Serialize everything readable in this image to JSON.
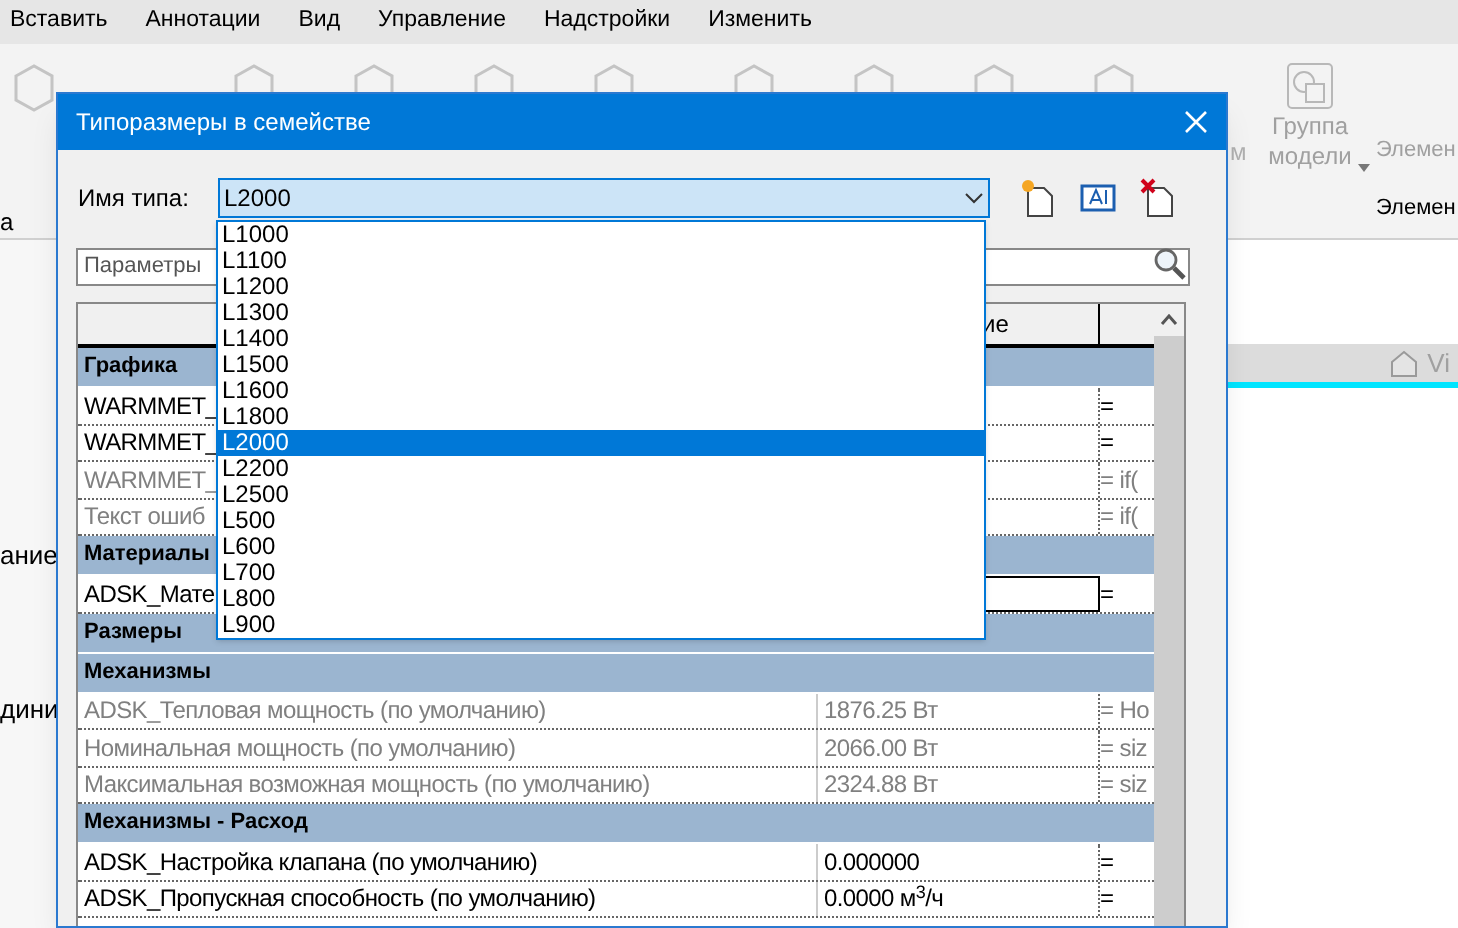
{
  "app": {
    "menu": [
      "Вставить",
      "Аннотации",
      "Вид",
      "Управление",
      "Надстройки",
      "Изменить"
    ],
    "ribbon": {
      "left_label": "а",
      "partial_label": "м",
      "group_button": [
        "Группа",
        "модели"
      ],
      "right_labels": [
        "Элемен",
        "Элемен"
      ]
    },
    "left_panel": [
      "ание",
      "дини"
    ],
    "view_tab": "Vi"
  },
  "dialog": {
    "title": "Типоразмеры в семействе",
    "type_name_label": "Имя типа:",
    "type_name_value": "L2000",
    "dropdown": [
      {
        "label": "L1000",
        "selected": false
      },
      {
        "label": "L1100",
        "selected": false
      },
      {
        "label": "L1200",
        "selected": false
      },
      {
        "label": "L1300",
        "selected": false
      },
      {
        "label": "L1400",
        "selected": false
      },
      {
        "label": "L1500",
        "selected": false
      },
      {
        "label": "L1600",
        "selected": false
      },
      {
        "label": "L1800",
        "selected": false
      },
      {
        "label": "L2000",
        "selected": true
      },
      {
        "label": "L2200",
        "selected": false
      },
      {
        "label": "L2500",
        "selected": false
      },
      {
        "label": "L500",
        "selected": false
      },
      {
        "label": "L600",
        "selected": false
      },
      {
        "label": "L700",
        "selected": false
      },
      {
        "label": "L800",
        "selected": false
      },
      {
        "label": "L900",
        "selected": false
      }
    ],
    "search_placeholder": "Параметры",
    "table": {
      "header": "ие",
      "groups": [
        {
          "name": "Графика",
          "rows": [
            {
              "name": "WARMMET_",
              "formula": "=",
              "dimmed": false
            },
            {
              "name": "WARMMET_",
              "formula": "=",
              "dimmed": false
            },
            {
              "name": "WARMMET_",
              "formula": "= if(",
              "dimmed": true
            },
            {
              "name": "Текст ошиб",
              "formula": "= if(",
              "dimmed": true
            }
          ]
        },
        {
          "name": "Материалы",
          "rows": [
            {
              "name": "ADSK_Мате",
              "formula": "=",
              "dimmed": false,
              "focused": true
            }
          ]
        },
        {
          "name": "Размеры"
        },
        {
          "name": "Механизмы",
          "rows": [
            {
              "name": "ADSK_Тепловая мощность (по умолчанию)",
              "value": "1876.25 Вт",
              "formula": "= Ho",
              "dimmed": true
            },
            {
              "name": "Номинальная мощность (по умолчанию)",
              "value": "2066.00 Вт",
              "formula": "= siz",
              "dimmed": true
            },
            {
              "name": "Максимальная возможная мощность (по умолчанию)",
              "value": "2324.88 Вт",
              "formula": "= siz",
              "dimmed": true
            }
          ]
        },
        {
          "name": "Механизмы - Расход",
          "rows": [
            {
              "name": "ADSK_Настройка клапана (по умолчанию)",
              "value": "0.000000",
              "formula": "=",
              "dimmed": false
            },
            {
              "name": "ADSK_Пропускная способность (по умолчанию)",
              "value": "0.0000 м$^{3}$/ч",
              "formula": "=",
              "dimmed": false
            }
          ]
        }
      ]
    }
  }
}
